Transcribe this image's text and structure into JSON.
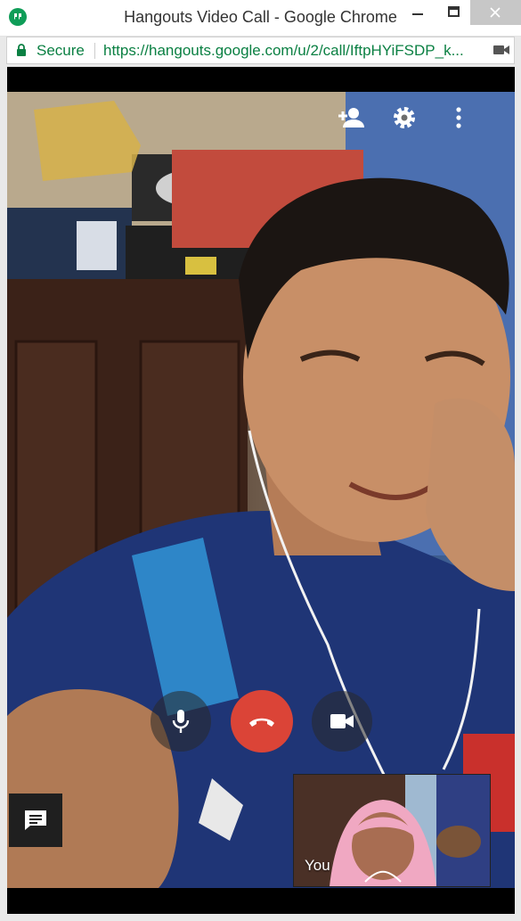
{
  "window": {
    "title": "Hangouts Video Call - Google Chrome"
  },
  "addressbar": {
    "secure_label": "Secure",
    "url": "https://hangouts.google.com/u/2/call/IftpHYiFSDP_k..."
  },
  "call": {
    "top_actions": [
      "add-person-icon",
      "settings-icon",
      "more-vert-icon"
    ],
    "controls": [
      "microphone-icon",
      "end-call-icon",
      "camera-icon"
    ],
    "self_view_label": "You",
    "colors": {
      "end_call": "#db4437",
      "secure_green": "#0b8043"
    }
  }
}
